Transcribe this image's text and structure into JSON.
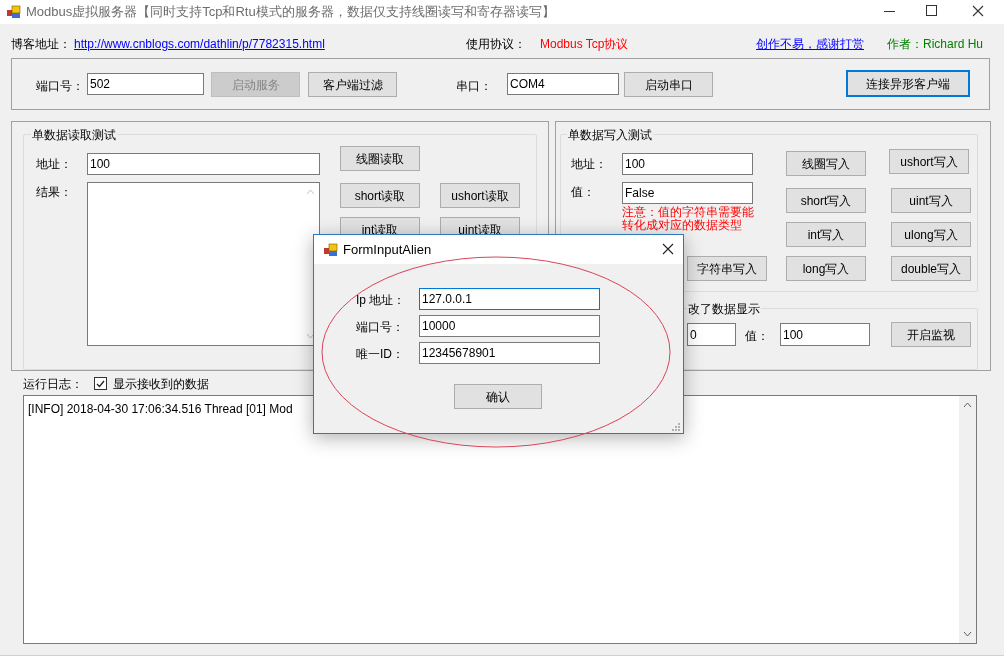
{
  "window": {
    "title": "Modbus虚拟服务器【同时支持Tcp和Rtu模式的服务器，数据仅支持线圈读写和寄存器读写】"
  },
  "info_bar": {
    "blog_label": "博客地址：",
    "blog_link": "http://www.cnblogs.com/dathlin/p/7782315.html",
    "protocol_label": "使用协议：",
    "protocol_value": "Modbus Tcp协议",
    "donate_link": "创作不易，感谢打赏",
    "author": "作者：Richard Hu"
  },
  "server_panel": {
    "port_label": "端口号：",
    "port_value": "502",
    "start_button": {
      "label": "启动服务",
      "disabled": true
    },
    "filter_button": {
      "label": "客户端过滤",
      "disabled": false
    },
    "serial_label": "串口：",
    "serial_value": "COM4",
    "serial_button": "启动串口",
    "alien_button": "连接异形客户端"
  },
  "read_group": {
    "title": "单数据读取测试",
    "address_label": "地址：",
    "address_value": "100",
    "result_label": "结果：",
    "buttons": [
      "线圈读取",
      "short读取",
      "ushort读取",
      "int读取",
      "uint读取"
    ]
  },
  "write_group": {
    "title": "单数据写入测试",
    "address_label": "地址：",
    "address_value": "100",
    "value_label": "值：",
    "value_value": "False",
    "note": "注意：值的字符串需要能转化成对应的数据类型",
    "buttons": [
      "线圈写入",
      "ushort写入",
      "short写入",
      "uint写入",
      "int写入",
      "ulong写入",
      "字符串写入",
      "long写入",
      "double写入"
    ]
  },
  "monitor_group": {
    "title": "改了数据显示",
    "address_value": "0",
    "value_label": "值：",
    "value_value": "100",
    "button": "开启监视"
  },
  "log": {
    "label": "运行日志：",
    "show_received": {
      "label": "显示接收到的数据",
      "checked": true
    },
    "lines": [
      "[INFO] 2018-04-30 17:06:34.516 Thread [01] Mod"
    ]
  },
  "dialog": {
    "title": "FormInputAlien",
    "fields": [
      {
        "label": "Ip 地址：",
        "value": "127.0.0.1",
        "focused": true
      },
      {
        "label": "端口号：",
        "value": "10000",
        "focused": false
      },
      {
        "label": "唯一ID：",
        "value": "12345678901",
        "focused": false
      }
    ],
    "confirm_button": "确认"
  }
}
